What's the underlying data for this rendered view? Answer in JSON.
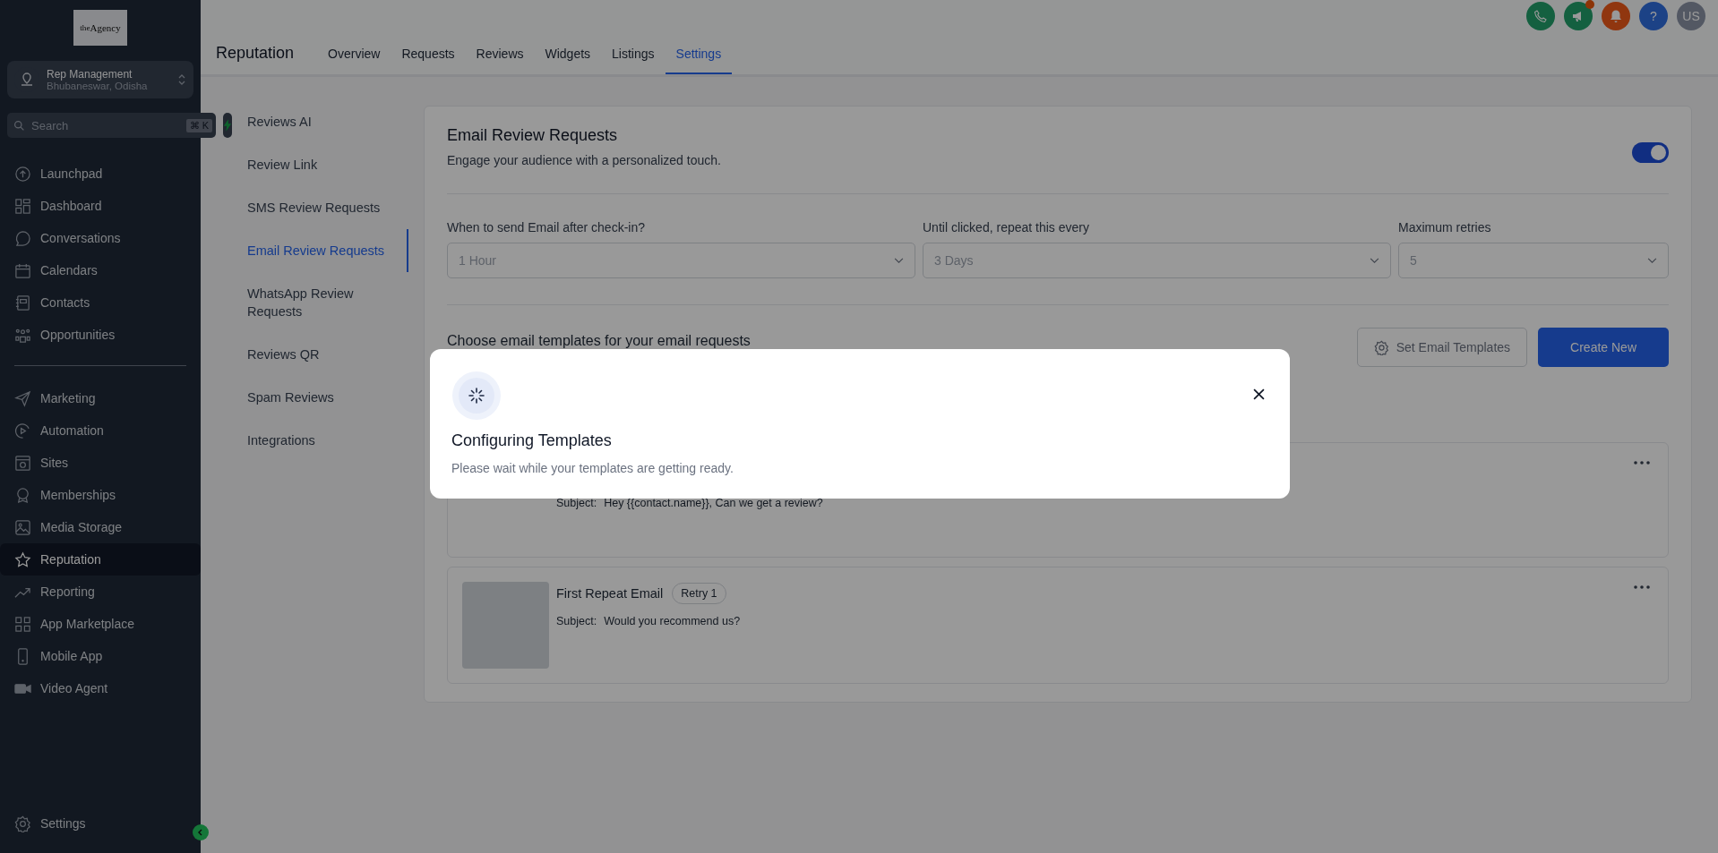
{
  "sidebar": {
    "logo": "$^{the}$Agency",
    "account": {
      "name": "Rep Management",
      "location": "Bhubaneswar, Odisha"
    },
    "search": {
      "placeholder": "Search",
      "shortcut": "⌘ K"
    },
    "nav_groups": [
      [
        {
          "label": "Launchpad",
          "selected": false
        },
        {
          "label": "Dashboard",
          "selected": false
        },
        {
          "label": "Conversations",
          "selected": false
        },
        {
          "label": "Calendars",
          "selected": false
        },
        {
          "label": "Contacts",
          "selected": false
        },
        {
          "label": "Opportunities",
          "selected": false
        }
      ],
      [
        {
          "label": "Marketing",
          "selected": false
        },
        {
          "label": "Automation",
          "selected": false
        },
        {
          "label": "Sites",
          "selected": false
        },
        {
          "label": "Memberships",
          "selected": false
        },
        {
          "label": "Media Storage",
          "selected": false
        },
        {
          "label": "Reputation",
          "selected": true
        },
        {
          "label": "Reporting",
          "selected": false
        },
        {
          "label": "App Marketplace",
          "selected": false
        },
        {
          "label": "Mobile App",
          "selected": false
        },
        {
          "label": "Video Agent",
          "selected": false
        }
      ]
    ],
    "settings": "Settings"
  },
  "header": {
    "title": "Reputation",
    "tabs": [
      {
        "label": "Overview",
        "selected": false
      },
      {
        "label": "Requests",
        "selected": false
      },
      {
        "label": "Reviews",
        "selected": false
      },
      {
        "label": "Widgets",
        "selected": false
      },
      {
        "label": "Listings",
        "selected": false
      },
      {
        "label": "Settings",
        "selected": true
      }
    ],
    "help": "?",
    "avatar": "US"
  },
  "settings_nav": [
    {
      "label": "Reviews AI",
      "selected": false
    },
    {
      "label": "Review Link",
      "selected": false
    },
    {
      "label": "SMS Review Requests",
      "selected": false
    },
    {
      "label": "Email Review Requests",
      "selected": true
    },
    {
      "label": "WhatsApp Review Requests",
      "selected": false
    },
    {
      "label": "Reviews QR",
      "selected": false
    },
    {
      "label": "Spam Reviews",
      "selected": false
    },
    {
      "label": "Integrations",
      "selected": false
    }
  ],
  "panel": {
    "title": "Email Review Requests",
    "subtitle": "Engage your audience with a personalized touch.",
    "enabled": true,
    "fields": [
      {
        "label": "When to send Email after check-in?",
        "value": "1 Hour"
      },
      {
        "label": "Until clicked, repeat this every",
        "value": "3 Days"
      },
      {
        "label": "Maximum retries",
        "value": "5"
      }
    ],
    "templates_heading": "Choose email templates for your email requests",
    "buttons": {
      "secondary": "Set Email Templates",
      "primary": "Create New"
    },
    "templates": [
      {
        "subject_label": "Subject:",
        "subject": "Hey {{contact.name}}, Can we get a review?"
      },
      {
        "title": "First Repeat Email",
        "badge": "Retry 1",
        "subject_label": "Subject:",
        "subject": "Would you recommend us?"
      }
    ]
  },
  "modal": {
    "title": "Configuring Templates",
    "message": "Please wait while your templates are getting ready."
  }
}
